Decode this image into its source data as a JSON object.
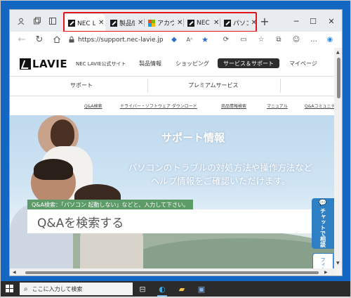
{
  "browser": {
    "tabs": [
      {
        "label": "NEC LAVIE公式サイト",
        "favicon": "lavie-icon"
      },
      {
        "label": "製品情報",
        "favicon": "lavie-icon"
      },
      {
        "label": "アカウント",
        "favicon": "microsoft-icon"
      },
      {
        "label": "NEC LAVIE",
        "favicon": "lavie-icon"
      },
      {
        "label": "パソコン",
        "favicon": "lavie-icon"
      }
    ],
    "new_tab": "+",
    "url": "https://support.nec-lavie.jp",
    "highlight_color": "#e0161a"
  },
  "site": {
    "logo": "LAVIE",
    "subtitle": "NEC LAVIE公式サイト",
    "menu": [
      "製品情報",
      "ショッピング",
      "サービス＆サポート",
      "マイページ"
    ],
    "selected_menu": "サービス＆サポート",
    "subnav": [
      "サポート",
      "プレミアムサービス"
    ],
    "links": [
      "Q&A検索",
      "ドライバー・ソフトウェア ダウンロード",
      "商品情報検索",
      "マニュアル",
      "Q&Aコミュニティ"
    ]
  },
  "hero": {
    "title": "サポート情報",
    "desc_line1": "パソコンのトラブルの対処方法や操作方法など",
    "desc_line2": "ヘルプ情報をご確認いただけます。",
    "search_hint": "Q&A検索：「パソコン 起動しない」などと、入力して下さい。",
    "search_placeholder": "Q&Aを検索する",
    "chat_button": "チャットで相談",
    "feedback_button": "フィードバック"
  },
  "taskbar": {
    "search_placeholder": "ここに入力して検索"
  }
}
